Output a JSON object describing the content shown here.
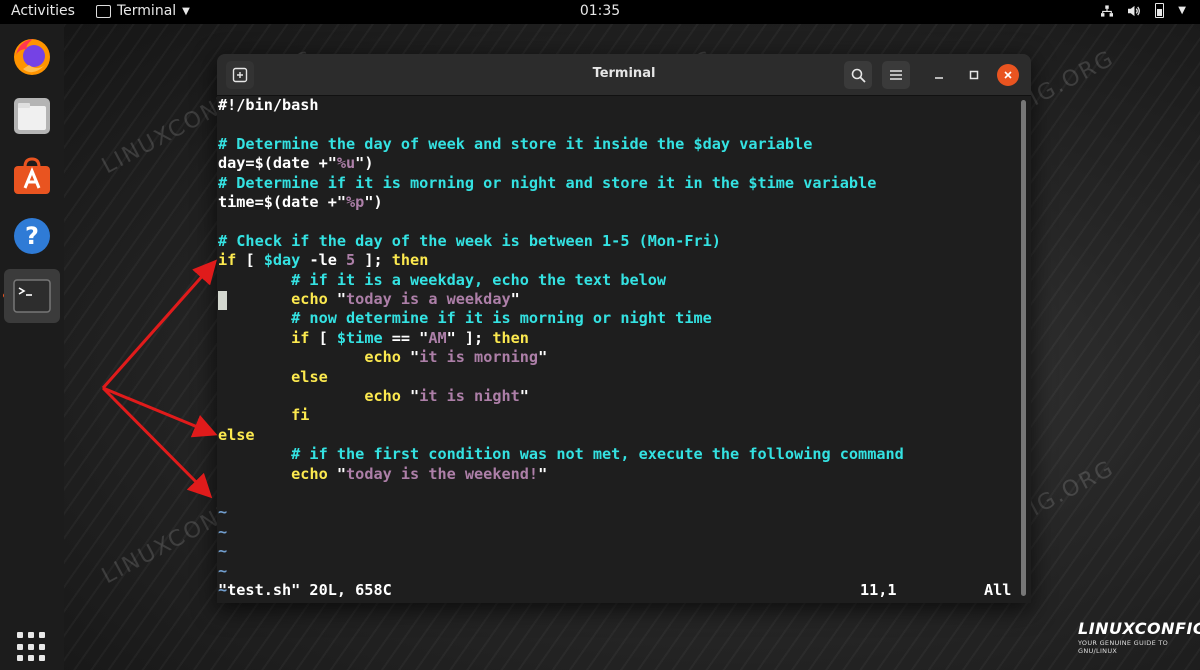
{
  "topbar": {
    "activities": "Activities",
    "app_name": "Terminal",
    "clock": "01:35"
  },
  "window": {
    "title": "Terminal"
  },
  "editor": {
    "lines": [
      {
        "segments": [
          {
            "t": "#!/bin/bash",
            "c": "plain"
          }
        ]
      },
      {
        "segments": []
      },
      {
        "segments": [
          {
            "t": "# Determine the day of week and store it inside the $day variable",
            "c": "comment"
          }
        ]
      },
      {
        "segments": [
          {
            "t": "day=$(date +\"",
            "c": "plain"
          },
          {
            "t": "%u",
            "c": "str"
          },
          {
            "t": "\")",
            "c": "plain"
          }
        ]
      },
      {
        "segments": [
          {
            "t": "# Determine if it is morning or night and store it in the $time variable",
            "c": "comment"
          }
        ]
      },
      {
        "segments": [
          {
            "t": "time=$(date +\"",
            "c": "plain"
          },
          {
            "t": "%p",
            "c": "str"
          },
          {
            "t": "\")",
            "c": "plain"
          }
        ]
      },
      {
        "segments": []
      },
      {
        "segments": [
          {
            "t": "# Check if the day of the week is between 1-5 (Mon-Fri)",
            "c": "comment"
          }
        ]
      },
      {
        "segments": [
          {
            "t": "if",
            "c": "key"
          },
          {
            "t": " [ ",
            "c": "plain"
          },
          {
            "t": "$day",
            "c": "var"
          },
          {
            "t": " -le ",
            "c": "plain"
          },
          {
            "t": "5",
            "c": "str"
          },
          {
            "t": " ]; ",
            "c": "plain"
          },
          {
            "t": "then",
            "c": "key"
          }
        ]
      },
      {
        "segments": [
          {
            "t": "        # if it is a weekday, echo the text below",
            "c": "comment"
          }
        ]
      },
      {
        "segments": [
          {
            "t": "        ",
            "c": "plain"
          },
          {
            "t": "echo",
            "c": "key"
          },
          {
            "t": " \"",
            "c": "plain"
          },
          {
            "t": "today is a weekday",
            "c": "str"
          },
          {
            "t": "\"",
            "c": "plain"
          }
        ]
      },
      {
        "segments": [
          {
            "t": "        # now determine if it is morning or night time",
            "c": "comment"
          }
        ]
      },
      {
        "segments": [
          {
            "t": "        ",
            "c": "plain"
          },
          {
            "t": "if",
            "c": "key"
          },
          {
            "t": " [ ",
            "c": "plain"
          },
          {
            "t": "$time",
            "c": "var"
          },
          {
            "t": " == \"",
            "c": "plain"
          },
          {
            "t": "AM",
            "c": "str"
          },
          {
            "t": "\" ]; ",
            "c": "plain"
          },
          {
            "t": "then",
            "c": "key"
          }
        ]
      },
      {
        "segments": [
          {
            "t": "                ",
            "c": "plain"
          },
          {
            "t": "echo",
            "c": "key"
          },
          {
            "t": " \"",
            "c": "plain"
          },
          {
            "t": "it is morning",
            "c": "str"
          },
          {
            "t": "\"",
            "c": "plain"
          }
        ]
      },
      {
        "segments": [
          {
            "t": "        ",
            "c": "plain"
          },
          {
            "t": "else",
            "c": "key"
          }
        ]
      },
      {
        "segments": [
          {
            "t": "                ",
            "c": "plain"
          },
          {
            "t": "echo",
            "c": "key"
          },
          {
            "t": " \"",
            "c": "plain"
          },
          {
            "t": "it is night",
            "c": "str"
          },
          {
            "t": "\"",
            "c": "plain"
          }
        ]
      },
      {
        "segments": [
          {
            "t": "        ",
            "c": "plain"
          },
          {
            "t": "fi",
            "c": "key"
          }
        ]
      },
      {
        "segments": [
          {
            "t": "else",
            "c": "key"
          }
        ]
      },
      {
        "segments": [
          {
            "t": "        # if the first condition was not met, execute the following command",
            "c": "comment"
          }
        ]
      },
      {
        "segments": [
          {
            "t": "        ",
            "c": "plain"
          },
          {
            "t": "echo",
            "c": "key"
          },
          {
            "t": " \"",
            "c": "plain"
          },
          {
            "t": "today is the weekend!",
            "c": "str"
          },
          {
            "t": "\"",
            "c": "plain"
          }
        ]
      },
      {
        "segments": []
      },
      {
        "segments": [
          {
            "t": "~",
            "c": "tilde"
          }
        ]
      },
      {
        "segments": [
          {
            "t": "~",
            "c": "tilde"
          }
        ]
      },
      {
        "segments": [
          {
            "t": "~",
            "c": "tilde"
          }
        ]
      },
      {
        "segments": [
          {
            "t": "~",
            "c": "tilde"
          }
        ]
      },
      {
        "segments": [
          {
            "t": "~",
            "c": "tilde"
          }
        ]
      }
    ],
    "status_file": "\"test.sh\" 20L, 658C",
    "status_pos": "11,1",
    "status_scroll": "All"
  },
  "watermark": "LINUXCONFIG.ORG",
  "logo": {
    "main": "LINUXCONFIG.org",
    "sub": "YOUR GENUINE GUIDE TO GNU/LINUX"
  },
  "colors": {
    "accent": "#e95420",
    "comment": "#34e2e2",
    "keyword": "#fce94f",
    "string": "#ad7fa8",
    "arrow": "#e01b1b"
  }
}
